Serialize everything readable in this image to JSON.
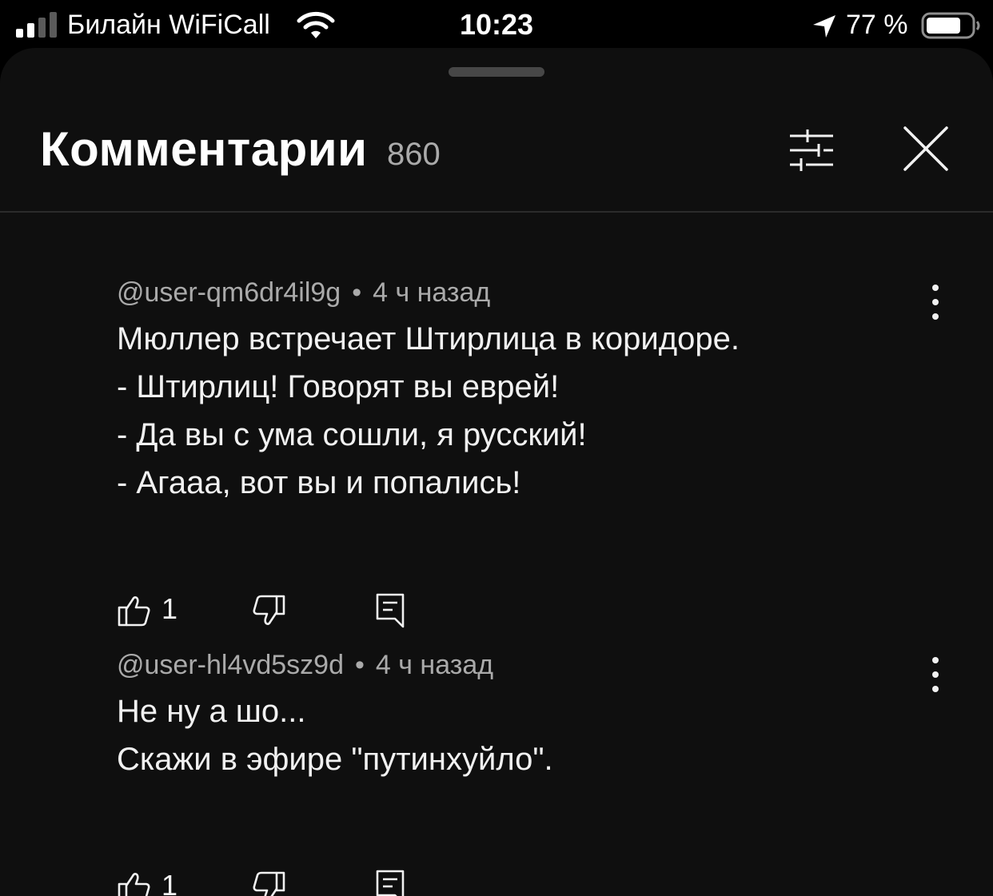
{
  "status_bar": {
    "carrier": "Билайн WiFiCall",
    "time": "10:23",
    "battery_percent": "77 %",
    "icons": [
      "signal-icon",
      "wifi-icon",
      "location-arrow-icon",
      "battery-icon"
    ],
    "battery_level": 0.77
  },
  "sheet": {
    "title": "Комментарии",
    "count": "860",
    "icons": [
      "sort-filter-icon",
      "close-icon"
    ]
  },
  "comments": [
    {
      "author": "@user-qm6dr4il9g",
      "separator": "•",
      "time": "4 ч назад",
      "lines": [
        "Мюллер встречает Штирлица в коридоре.",
        "- Штирлиц! Говорят вы еврей!",
        "- Да вы с ума сошли, я русский!",
        "- Агааа, вот вы и попались!"
      ],
      "likes": "1",
      "icons": [
        "more-vert-icon",
        "thumb-up-icon",
        "thumb-down-icon",
        "reply-icon"
      ]
    },
    {
      "author": "@user-hl4vd5sz9d",
      "separator": "•",
      "time": "4 ч назад",
      "lines": [
        "Не ну а шо...",
        "Скажи в эфире \"путинхуйло\"."
      ],
      "likes": "1",
      "icons": [
        "more-vert-icon",
        "thumb-up-icon",
        "thumb-down-icon",
        "reply-icon"
      ]
    }
  ],
  "colors": {
    "background": "#000000",
    "sheet": "#0f0f0f",
    "primary_text": "#f1f1f1",
    "secondary_text": "#aaaaaa",
    "divider": "#2b2b2b"
  }
}
